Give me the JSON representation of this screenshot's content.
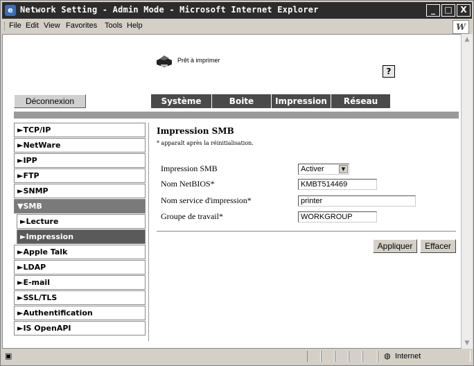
{
  "window": {
    "title": "Network Setting - Admin Mode - Microsoft Internet Explorer",
    "controls": [
      "_",
      "□",
      "X"
    ]
  },
  "menubar": {
    "items": [
      "File",
      "Edit",
      "View",
      "Favorites",
      "Tools",
      "Help"
    ]
  },
  "page": {
    "printer_status": "Prêt à imprimer",
    "help_label": "?",
    "logout_label": "Déconnexion",
    "topnav": [
      "Système",
      "Boite",
      "Impression",
      "Réseau"
    ],
    "sidebar": [
      "►TCP/IP",
      "►NetWare",
      "►IPP",
      "►FTP",
      "►SNMP",
      "▼SMB",
      "►Lecture",
      "►Impression",
      "►Apple Talk",
      "►LDAP",
      "►E-mail",
      "►SSL/TLS",
      "►Authentification",
      "►IS OpenAPI"
    ],
    "section_title": "Impression SMB",
    "section_note": "* apparaît après la réinitialisation.",
    "form": {
      "smb_print_label": "Impression SMB",
      "smb_print_value": "Activer",
      "netbios_label": "Nom NetBIOS*",
      "netbios_value": "KMBT514469",
      "print_service_label": "Nom service d'impression*",
      "print_service_value": "printer",
      "workgroup_label": "Groupe de travail*",
      "workgroup_value": "WORKGROUP"
    },
    "apply_label": "Appliquer",
    "clear_label": "Effacer"
  },
  "statusbar": {
    "zone_label": "Internet"
  }
}
